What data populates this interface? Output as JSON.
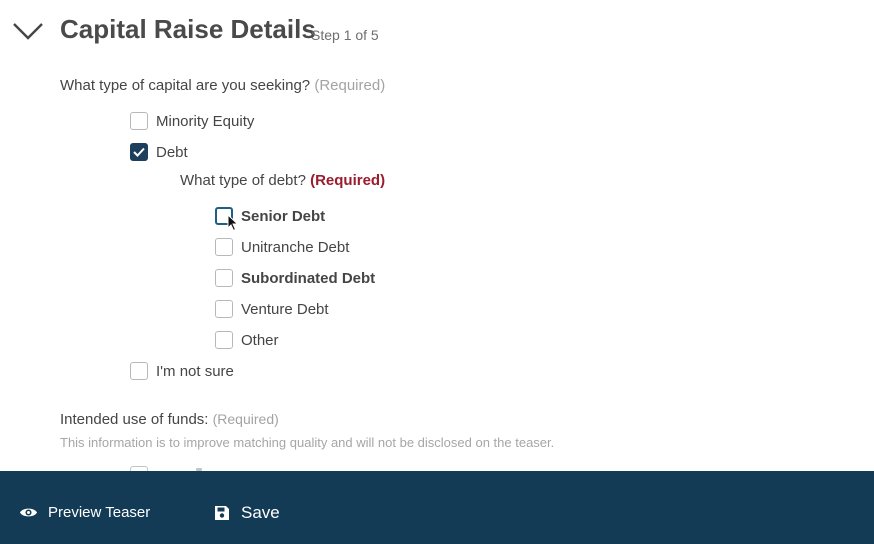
{
  "header": {
    "title": "Capital Raise Details",
    "step": "Step 1 of 5",
    "collapse_icon": "chevron-down-icon"
  },
  "capital_question": {
    "label": "What type of capital are you seeking?",
    "required": "(Required)",
    "options": [
      {
        "label": "Minority Equity",
        "checked": false
      },
      {
        "label": "Debt",
        "checked": true
      },
      {
        "label": "I'm not sure",
        "checked": false
      }
    ]
  },
  "debt_question": {
    "label": "What type of debt?",
    "required": "(Required)",
    "options": [
      {
        "label": "Senior Debt",
        "checked": false,
        "focused": true
      },
      {
        "label": "Unitranche Debt",
        "checked": false
      },
      {
        "label": "Subordinated Debt",
        "checked": false
      },
      {
        "label": "Venture Debt",
        "checked": false
      },
      {
        "label": "Other",
        "checked": false
      }
    ]
  },
  "funds_question": {
    "label": "Intended use of funds:",
    "required": "(Required)",
    "hint": "This information is to improve matching quality and will not be disclosed on the teaser."
  },
  "footer": {
    "preview_label": "Preview Teaser",
    "preview_icon": "eye-icon",
    "save_label": "Save",
    "save_icon": "floppy-disk-icon"
  },
  "colors": {
    "footer_bg": "#133b55",
    "checked_bg": "#1b3f5c",
    "required_red": "#9b1c2e"
  }
}
